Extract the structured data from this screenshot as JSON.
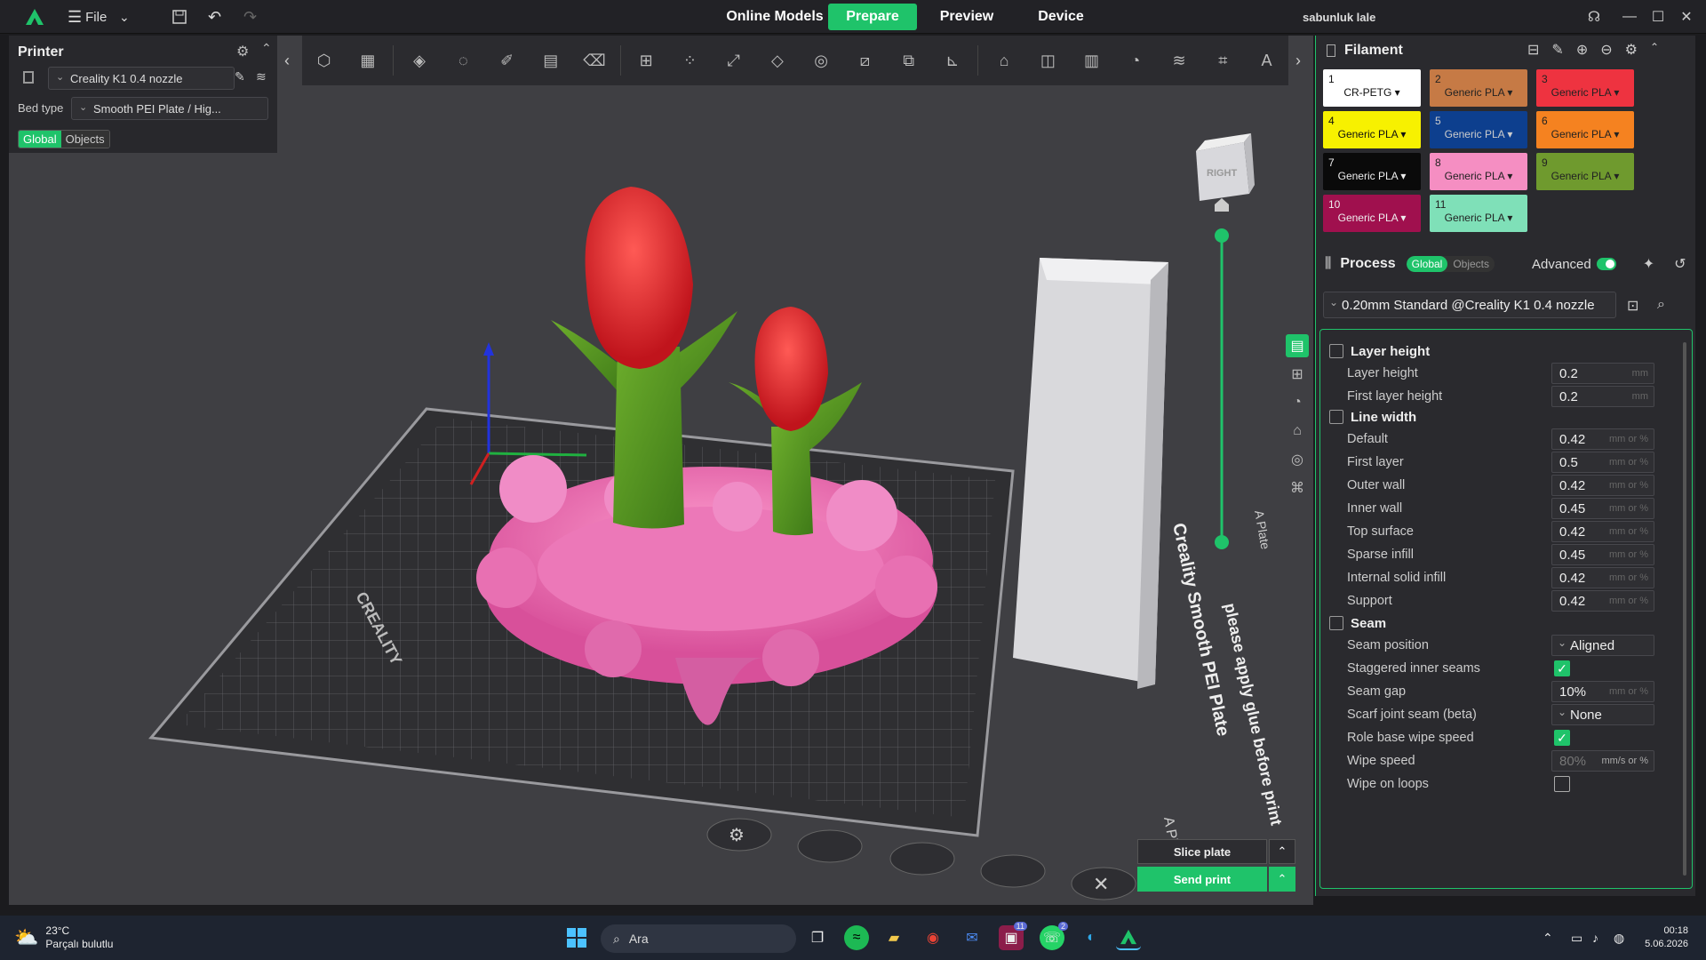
{
  "topbar": {
    "file_label": "File",
    "tabs": [
      "Online Models",
      "Prepare",
      "Preview",
      "Device"
    ],
    "active_tab": "Prepare",
    "username": "sabunluk lale"
  },
  "printer_panel": {
    "title": "Printer",
    "printer_name": "Creality K1 0.4 nozzle",
    "bed_type_label": "Bed type",
    "bed_type_value": "Smooth PEI Plate / Hig...",
    "global_label": "Global",
    "objects_label": "Objects"
  },
  "viewport": {
    "view_cube_label": "RIGHT",
    "plate_brand": "CREALITY",
    "plate_text": "Creality Smooth PEI Plate",
    "plate_note": "please apply glue before print",
    "plate_tag": "A Plate"
  },
  "filament": {
    "title": "Filament",
    "items": [
      {
        "num": "1",
        "name": "CR-PETG",
        "color": "#ffffff",
        "text": "#111111"
      },
      {
        "num": "2",
        "name": "Generic PLA",
        "color": "#c67a45",
        "text": "#222222"
      },
      {
        "num": "3",
        "name": "Generic PLA",
        "color": "#ee3340",
        "text": "#222222"
      },
      {
        "num": "4",
        "name": "Generic PLA",
        "color": "#f7f100",
        "text": "#111111"
      },
      {
        "num": "5",
        "name": "Generic PLA",
        "color": "#0d3f8e",
        "text": "#cccccc"
      },
      {
        "num": "6",
        "name": "Generic PLA",
        "color": "#f58220",
        "text": "#222222"
      },
      {
        "num": "7",
        "name": "Generic PLA",
        "color": "#0a0a0a",
        "text": "#eeeeee"
      },
      {
        "num": "8",
        "name": "Generic PLA",
        "color": "#f58ec2",
        "text": "#222222"
      },
      {
        "num": "9",
        "name": "Generic PLA",
        "color": "#6f9a2e",
        "text": "#222222"
      },
      {
        "num": "10",
        "name": "Generic PLA",
        "color": "#a0104e",
        "text": "#eeeeee"
      },
      {
        "num": "11",
        "name": "Generic PLA",
        "color": "#7fe0b8",
        "text": "#222222"
      }
    ]
  },
  "process": {
    "title": "Process",
    "global_label": "Global",
    "objects_label": "Objects",
    "advanced_label": "Advanced",
    "preset": "0.20mm Standard @Creality K1 0.4 nozzle"
  },
  "params": {
    "layer_height_section": "Layer height",
    "layer_height": {
      "label": "Layer height",
      "value": "0.2",
      "unit": "mm"
    },
    "first_layer_height": {
      "label": "First layer height",
      "value": "0.2",
      "unit": "mm"
    },
    "line_width_section": "Line width",
    "line_widths": [
      {
        "label": "Default",
        "value": "0.42",
        "unit": "mm or %"
      },
      {
        "label": "First layer",
        "value": "0.5",
        "unit": "mm or %"
      },
      {
        "label": "Outer wall",
        "value": "0.42",
        "unit": "mm or %"
      },
      {
        "label": "Inner wall",
        "value": "0.45",
        "unit": "mm or %"
      },
      {
        "label": "Top surface",
        "value": "0.42",
        "unit": "mm or %"
      },
      {
        "label": "Sparse infill",
        "value": "0.45",
        "unit": "mm or %"
      },
      {
        "label": "Internal solid infill",
        "value": "0.42",
        "unit": "mm or %"
      },
      {
        "label": "Support",
        "value": "0.42",
        "unit": "mm or %"
      }
    ],
    "seam_section": "Seam",
    "seam_position": {
      "label": "Seam position",
      "value": "Aligned"
    },
    "staggered": {
      "label": "Staggered inner seams"
    },
    "seam_gap": {
      "label": "Seam gap",
      "value": "10%",
      "unit": "mm or %"
    },
    "scarf": {
      "label": "Scarf joint seam (beta)",
      "value": "None"
    },
    "role_wipe": {
      "label": "Role base wipe speed"
    },
    "wipe_speed": {
      "label": "Wipe speed",
      "value": "80%",
      "unit": "mm/s or %"
    },
    "wipe_loops": {
      "label": "Wipe on loops"
    }
  },
  "actions": {
    "slice": "Slice plate",
    "send": "Send print"
  },
  "taskbar": {
    "temp": "23°C",
    "weather": "Parçalı bulutlu",
    "search": "Ara",
    "time": "00:18",
    "date": "5.06.2026",
    "badge_mail": "11",
    "badge_whatsapp": "2"
  }
}
